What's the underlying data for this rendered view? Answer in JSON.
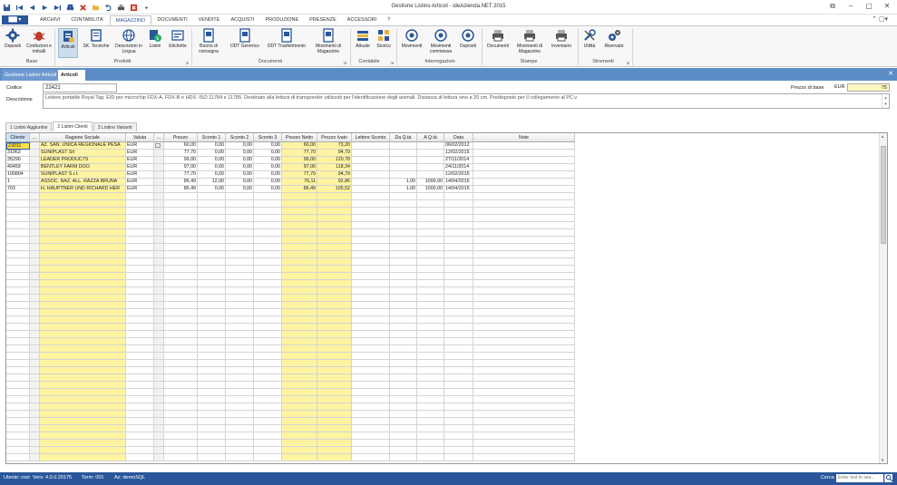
{
  "window": {
    "title": "Gestione Listino Articoli - ideAzienda.NET 2015",
    "controls": [
      "⧉",
      "–",
      "▢",
      "✕"
    ]
  },
  "ribbon_tabs": [
    "ARCHIVI",
    "CONTABILITA'",
    "MAGAZZINO",
    "DOCUMENTI",
    "VENDITE",
    "ACQUISTI",
    "PRODUZIONE",
    "PRESENZE",
    "ACCESSORI",
    "?"
  ],
  "file_tab": "▇▇ ▾",
  "ribbon": {
    "buttons": [
      {
        "label": "Depositi",
        "icon": "gear-icon"
      },
      {
        "label": "Confezioni e imballi",
        "icon": "bug-icon"
      },
      {
        "label": "Articoli",
        "icon": "article-icon"
      },
      {
        "label": "SK. Tecniche",
        "icon": "sheet-icon"
      },
      {
        "label": "Descrizioni in Lingua",
        "icon": "globe-icon"
      },
      {
        "label": "Listini",
        "icon": "price-list-icon"
      },
      {
        "label": "Etichette",
        "icon": "label-icon"
      },
      {
        "label": "Buono di consegna",
        "icon": "doc-icon"
      },
      {
        "label": "DDT Generico",
        "icon": "doc-icon"
      },
      {
        "label": "DDT Trasferimento",
        "icon": "doc-icon"
      },
      {
        "label": "Movimenti di Magazzino",
        "icon": "doc-icon"
      },
      {
        "label": "Attuale",
        "icon": "bars-icon"
      },
      {
        "label": "Storico",
        "icon": "grid-icon"
      },
      {
        "label": "Movimenti",
        "icon": "eye-icon"
      },
      {
        "label": "Movimenti commessa",
        "icon": "eye-icon"
      },
      {
        "label": "Depositi",
        "icon": "eye-icon"
      },
      {
        "label": "Documenti",
        "icon": "printer-icon"
      },
      {
        "label": "Movimenti di Magazzino",
        "icon": "printer-icon"
      },
      {
        "label": "Inventario",
        "icon": "printer-icon"
      },
      {
        "label": "Utilità",
        "icon": "tools-icon"
      },
      {
        "label": "Riservato",
        "icon": "cogs-icon"
      }
    ],
    "groups": [
      "Base",
      "Prodotti",
      "Documenti",
      "Contabile",
      "Interrogazioni",
      "Stampe",
      "Strumenti"
    ]
  },
  "doc_tabs": [
    "Gestione Listino Articoli",
    "Articoli"
  ],
  "form": {
    "codice_label": "Codice",
    "codice_value": "22421",
    "descrizione_label": "Descrizione",
    "descrizione_value": "Lettore portatile Royal Tag. EID per microchip FDX-A, FDX-B e HDX. ISO 11784 e 11785. Destinato alla lettura di transponder utilizzati per l'identificazione degli animali. Distanza di lettura sino a 20 cm. Predisposto per il collegamento al PC.v",
    "prezzo_label": "Prezzo di base",
    "currency": "EUR",
    "prezzo_value": "75"
  },
  "sub_tabs": [
    "1 Listini Aggiuntivi",
    "2 Listini Clienti",
    "3 Listino Varianti"
  ],
  "table": {
    "columns": [
      "Cliente",
      "...",
      "Ragione Sociale",
      "Valuta",
      "...",
      "Prezzo",
      "Sconto 1",
      "Sconto 2",
      "Sconto 3",
      "Prezzo Netto",
      "Prezzo Ivato",
      "Lettere Sconto",
      "Da Q.tà",
      "A Q.tà",
      "Data",
      "Note"
    ],
    "rows": [
      [
        "23011",
        "",
        "AZ. SAN. UNICA REGIONALE PESA",
        "EUR",
        "",
        "60,00",
        "0,00",
        "0,00",
        "0,00",
        "60,00",
        "73,20",
        "",
        "",
        "",
        "06/02/2012",
        ""
      ],
      [
        "31963",
        "",
        "SUNIPLAST Srl",
        "EUR",
        "",
        "77,70",
        "0,00",
        "0,00",
        "0,00",
        "77,70",
        "94,79",
        "",
        "",
        "",
        "12/02/2015",
        ""
      ],
      [
        "35290",
        "",
        "LEADER PRODUCTS",
        "EUR",
        "",
        "99,00",
        "0,00",
        "0,00",
        "0,00",
        "99,00",
        "120,78",
        "",
        "",
        "",
        "27/11/2014",
        ""
      ],
      [
        "40459",
        "",
        "BENTLEY FARM DOO",
        "EUR",
        "",
        "97,00",
        "0,00",
        "0,00",
        "0,00",
        "97,00",
        "118,34",
        "",
        "",
        "",
        "24/11/2014",
        ""
      ],
      [
        "100804",
        "",
        "SUNIPLAST S.r.l.",
        "EUR",
        "",
        "77,70",
        "0,00",
        "0,00",
        "0,00",
        "77,70",
        "94,79",
        "",
        "",
        "",
        "12/02/2015",
        ""
      ],
      [
        "1",
        "",
        "ASSOC. NAZ. ALL. RAZZA BRUNA",
        "EUR",
        "",
        "86,49",
        "12,00",
        "0,00",
        "0,00",
        "76,11",
        "92,86",
        "",
        "1,00",
        "1000,00",
        "14/04/2015",
        ""
      ],
      [
        "703",
        "",
        "H. HAUPTNER UND RICHARD HER",
        "EUR",
        "",
        "86,49",
        "0,00",
        "0,00",
        "0,00",
        "86,49",
        "105,52",
        "",
        "1,00",
        "1000,00",
        "14/04/2015",
        ""
      ]
    ]
  },
  "status": {
    "utente": "Utente: root",
    "vers": "Vers: 4.0.0.20175",
    "term": "Term: 001",
    "az": "Az: demoSQL",
    "cerca": "Cerca",
    "search_placeholder": "Enter text to sea..."
  },
  "colors": {
    "accent": "#2b579a",
    "highlight": "#fff4a0",
    "doctab": "#5b8cc6"
  }
}
